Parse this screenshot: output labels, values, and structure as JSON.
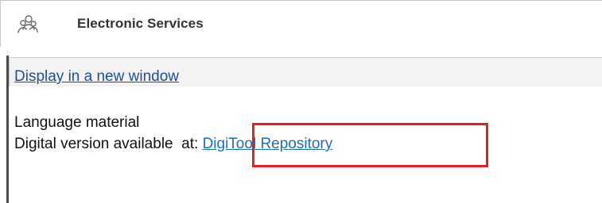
{
  "header": {
    "title": "Electronic Services",
    "icon": "users-group-icon"
  },
  "actions": {
    "display_new_window": "Display in a new window"
  },
  "record": {
    "material_type": "Language material",
    "availability_prefix": "Digital version available  at:",
    "repository_link": "DigiTool Repository"
  },
  "colors": {
    "highlight": "#e0211f",
    "link": "#1f6fb0"
  }
}
